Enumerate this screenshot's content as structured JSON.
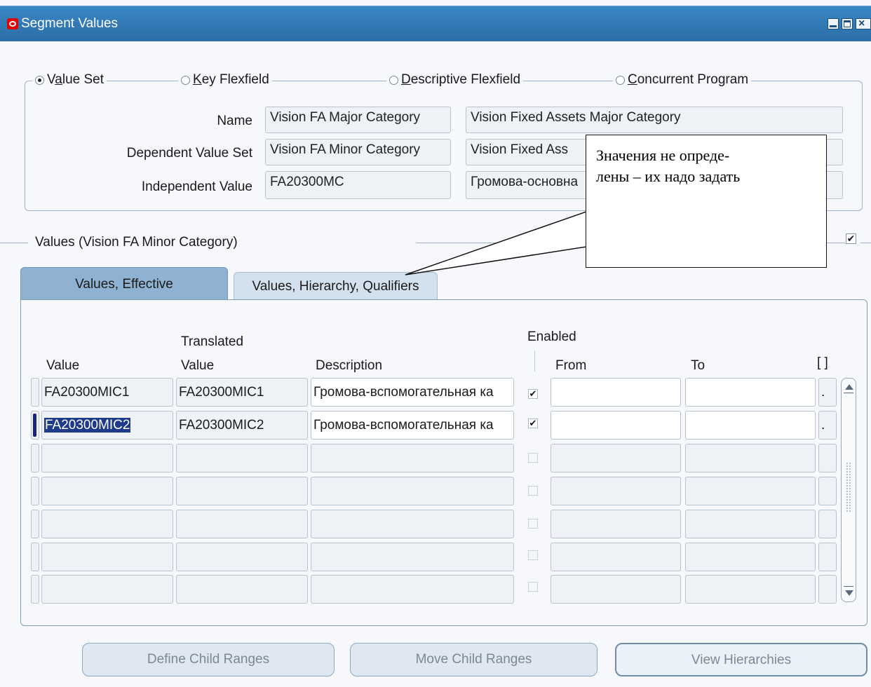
{
  "window": {
    "title": "Segment Values"
  },
  "radio_group": {
    "options": [
      "Value Set",
      "Key Flexfield",
      "Descriptive Flexfield",
      "Concurrent Program"
    ],
    "selected": "Value Set"
  },
  "fields": {
    "name_label": "Name",
    "name_value": "Vision FA Major Category",
    "name_description": "Vision Fixed Assets Major Category",
    "dependent_label": "Dependent Value Set",
    "dependent_value": "Vision FA Minor Category",
    "dependent_description": "Vision Fixed Ass",
    "independent_label": "Independent Value",
    "independent_value": "FA20300MC",
    "independent_description": "Громова-основна"
  },
  "values_section": {
    "title": "Values (Vision FA Minor Category)",
    "checkbox_checked": true
  },
  "tabs": [
    {
      "label": "Values, Effective",
      "active": true
    },
    {
      "label": "Values, Hierarchy, Qualifiers",
      "active": false
    }
  ],
  "table": {
    "headers": {
      "value": "Value",
      "translated_top": "Translated",
      "translated_bottom": "Value",
      "description": "Description",
      "enabled": "Enabled",
      "from": "From",
      "to": "To",
      "flex": "[ ]"
    },
    "rows": [
      {
        "value": "FA20300MIC1",
        "translated": "FA20300MIC1",
        "description": "Громова-вспомогательная ка",
        "enabled": true,
        "from": "",
        "to": "",
        "flex": "."
      },
      {
        "value": "FA20300MIC2",
        "translated": "FA20300MIC2",
        "description": "Громова-вспомогательная ка",
        "enabled": true,
        "from": "",
        "to": "",
        "flex": "."
      },
      {
        "value": "",
        "translated": "",
        "description": "",
        "enabled": false,
        "from": "",
        "to": "",
        "flex": ""
      },
      {
        "value": "",
        "translated": "",
        "description": "",
        "enabled": false,
        "from": "",
        "to": "",
        "flex": ""
      },
      {
        "value": "",
        "translated": "",
        "description": "",
        "enabled": false,
        "from": "",
        "to": "",
        "flex": ""
      },
      {
        "value": "",
        "translated": "",
        "description": "",
        "enabled": false,
        "from": "",
        "to": "",
        "flex": ""
      },
      {
        "value": "",
        "translated": "",
        "description": "",
        "enabled": false,
        "from": "",
        "to": "",
        "flex": ""
      }
    ]
  },
  "buttons": {
    "define_child_ranges": "Define Child Ranges",
    "move_child_ranges": "Move Child Ranges",
    "view_hierarchies": "View Hierarchies"
  },
  "callout": {
    "line1": "Значения не опреде-",
    "line2": "лены – их надо задать"
  }
}
